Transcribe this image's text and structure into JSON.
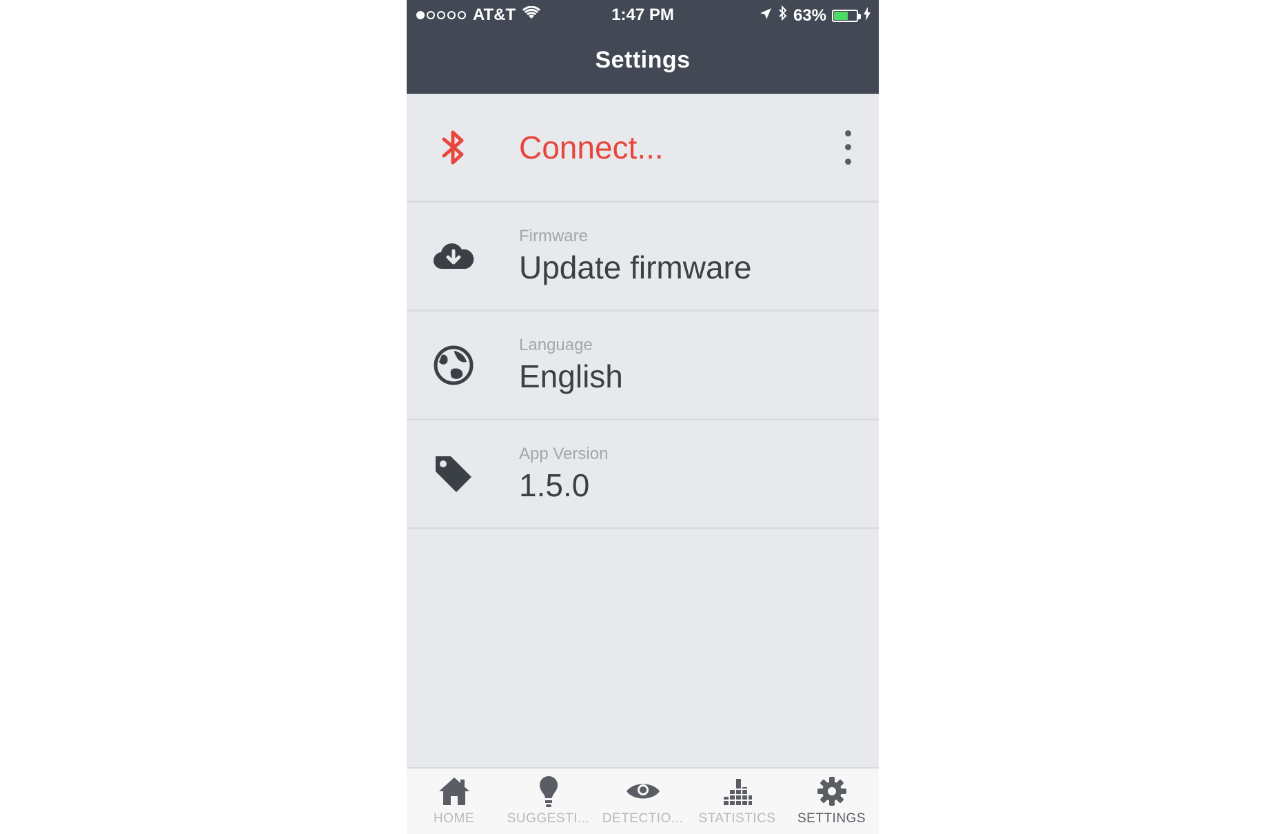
{
  "status_bar": {
    "carrier": "AT&T",
    "time": "1:47 PM",
    "battery_percent": "63%",
    "battery_level": 0.63,
    "signal_bars_filled": 1,
    "signal_bars_total": 5
  },
  "nav": {
    "title": "Settings"
  },
  "settings": {
    "connect": {
      "value": "Connect..."
    },
    "firmware": {
      "label": "Firmware",
      "value": "Update firmware"
    },
    "language": {
      "label": "Language",
      "value": "English"
    },
    "version": {
      "label": "App Version",
      "value": "1.5.0"
    }
  },
  "tabs": [
    {
      "label": "HOME",
      "icon": "home-icon"
    },
    {
      "label": "SUGGESTI...",
      "icon": "lightbulb-icon"
    },
    {
      "label": "DETECTIO...",
      "icon": "eye-icon"
    },
    {
      "label": "STATISTICS",
      "icon": "statistics-icon"
    },
    {
      "label": "SETTINGS",
      "icon": "gear-icon",
      "active": true
    }
  ],
  "colors": {
    "header": "#434954",
    "accent_red": "#e8463d",
    "background": "#e8e9ec",
    "battery_green": "#4cd964"
  }
}
